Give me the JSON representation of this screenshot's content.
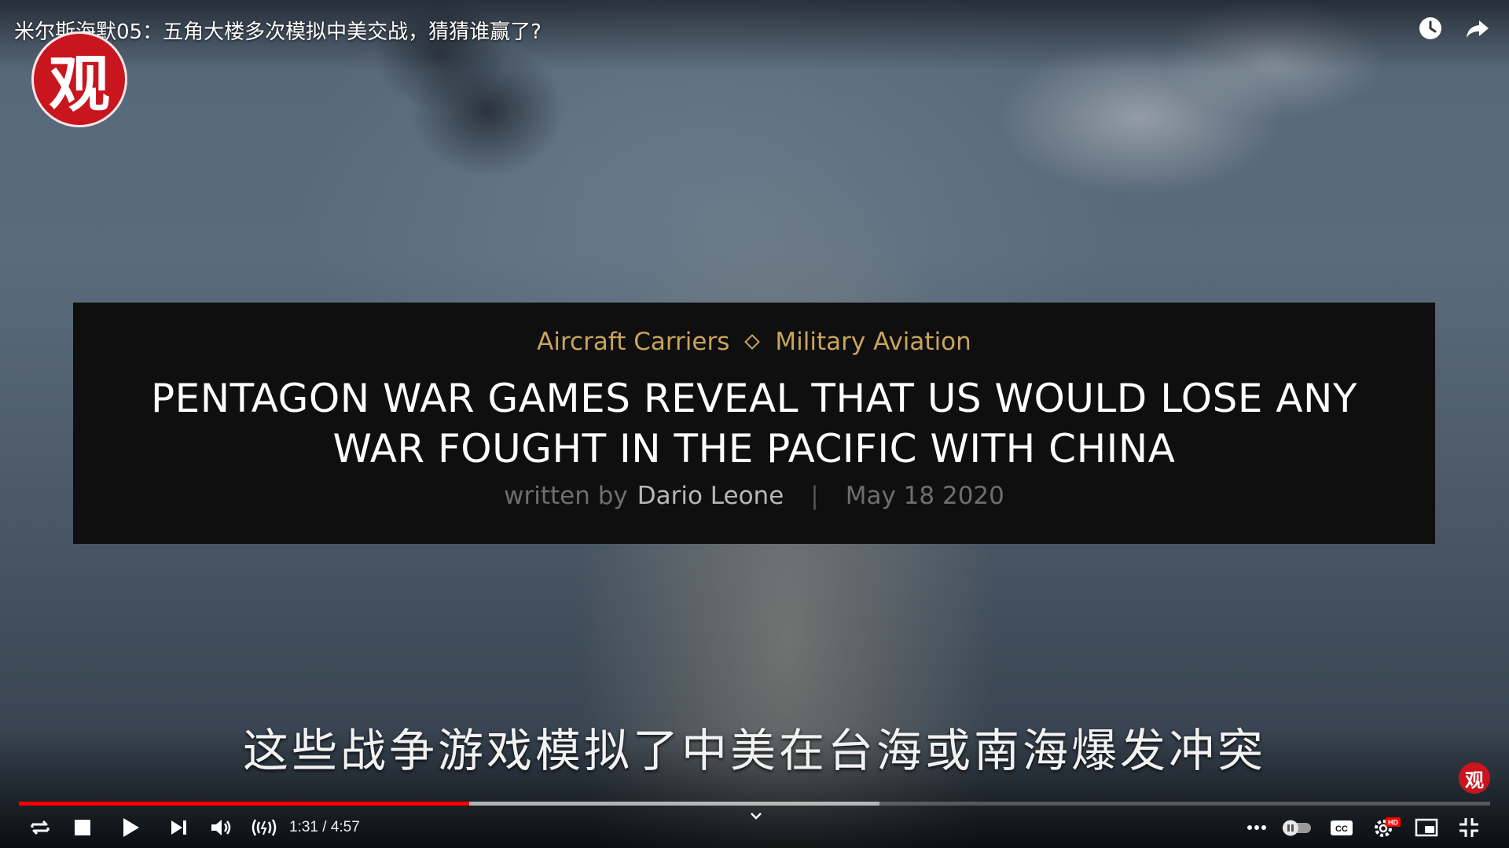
{
  "video": {
    "title": "米尔斯海默05：五角大楼多次模拟中美交战，猜猜谁赢了?",
    "logo_char": "观",
    "watermark_char": "观"
  },
  "headline_card": {
    "category_1": "Aircraft Carriers",
    "category_2": "Military Aviation",
    "headline": "PENTAGON WAR GAMES REVEAL THAT US WOULD LOSE ANY WAR FOUGHT IN THE PACIFIC WITH CHINA",
    "written_by": "written by",
    "author": "Dario Leone",
    "separator": "|",
    "date": "May 18 2020"
  },
  "subtitle": "这些战争游戏模拟了中美在台海或南海爆发冲突",
  "player": {
    "current_time": "1:31",
    "duration": "4:57",
    "time_display": "1:31 / 4:57",
    "played_fraction": 0.306,
    "buffered_fraction": 0.585,
    "colors": {
      "progress": "#ff0000",
      "category": "#c9a55c",
      "logo": "#c9151e"
    }
  },
  "icons": {
    "top": [
      "clock-icon",
      "share-icon"
    ],
    "controls_left": [
      "loop-icon",
      "stop-icon",
      "play-icon",
      "next-icon",
      "volume-icon",
      "live-icon"
    ],
    "controls_right": [
      "more-icon",
      "autoplay-toggle-icon",
      "cc-icon",
      "settings-hd-icon",
      "miniplayer-icon",
      "exit-fullscreen-icon"
    ]
  }
}
